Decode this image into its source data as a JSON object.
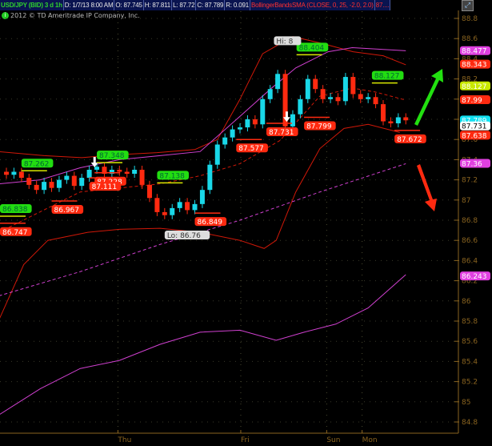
{
  "header": {
    "symbol": "USD/JPY (BID) 3 d 1h",
    "date": "D: 1/7/13 8:00 AM",
    "open": "O: 87.745",
    "high": "H: 87.811",
    "low": "L: 87.72",
    "close": "C: 87.789",
    "range": "R: 0.091",
    "study": "BollingerBandsSMA (CLOSE, 0, 25, -2.0, 2.0)",
    "more": "87...."
  },
  "copyright": "2012 © TD Ameritrade IP Company, Inc.",
  "colors": {
    "up": "#19d8e8",
    "down": "#ff2a10",
    "band": "#d01808",
    "sma": "#d040d0",
    "axis": "#8a6420",
    "green_tag": "#22dd11",
    "red_tag": "#ff2a10"
  },
  "chart_data": {
    "type": "candlestick",
    "title": "USD/JPY (BID) 3 d 1h",
    "ylim": [
      84.7,
      88.9
    ],
    "y_ticks": [
      "88.8",
      "88.6",
      "88.4",
      "88.2",
      "88",
      "87.8",
      "87.6",
      "87.4",
      "87.2",
      "87",
      "86.8",
      "86.6",
      "86.4",
      "86.2",
      "86",
      "85.8",
      "85.6",
      "85.4",
      "85.2",
      "85",
      "84.8"
    ],
    "x_ticks": [
      {
        "label": "Thu",
        "index": 14.8
      },
      {
        "label": "Fri",
        "index": 31.1
      },
      {
        "label": "Sun",
        "index": 42.5
      },
      {
        "label": "Mon",
        "index": 47.2
      }
    ],
    "closes": [
      87.25,
      87.28,
      87.22,
      87.15,
      87.1,
      87.18,
      87.12,
      87.2,
      87.24,
      87.14,
      87.22,
      87.3,
      87.33,
      87.26,
      87.3,
      87.28,
      87.26,
      87.3,
      87.15,
      87.02,
      86.88,
      86.85,
      86.92,
      86.98,
      86.9,
      86.96,
      87.1,
      87.35,
      87.55,
      87.62,
      87.7,
      87.72,
      87.8,
      87.75,
      88.0,
      88.1,
      88.25,
      87.73,
      87.85,
      88.0,
      88.2,
      88.1,
      88.0,
      88.02,
      87.98,
      88.22,
      88.05,
      88.0,
      88.02,
      87.95,
      87.78,
      87.76,
      87.82,
      87.79
    ],
    "lines": [
      {
        "name": "upper-band",
        "color": "#d01808",
        "dash": false,
        "points": [
          [
            -1,
            87.48
          ],
          [
            5,
            87.44
          ],
          [
            10,
            87.42
          ],
          [
            15,
            87.45
          ],
          [
            20,
            87.47
          ],
          [
            25,
            87.5
          ],
          [
            28,
            87.6
          ],
          [
            31,
            88.0
          ],
          [
            34,
            88.45
          ],
          [
            38,
            88.62
          ],
          [
            42,
            88.55
          ],
          [
            46,
            88.47
          ],
          [
            50,
            88.43
          ],
          [
            53,
            88.34
          ]
        ]
      },
      {
        "name": "lower-band",
        "color": "#d01808",
        "dash": false,
        "points": [
          [
            -1,
            85.81
          ],
          [
            2.3,
            86.36
          ],
          [
            5.5,
            86.6
          ],
          [
            10.8,
            86.68
          ],
          [
            15,
            86.71
          ],
          [
            20.4,
            86.72
          ],
          [
            25.7,
            86.68
          ],
          [
            31,
            86.6
          ],
          [
            34.2,
            86.52
          ],
          [
            35.8,
            86.6
          ],
          [
            38.4,
            87.08
          ],
          [
            41.6,
            87.51
          ],
          [
            44.8,
            87.71
          ],
          [
            48,
            87.75
          ],
          [
            52.2,
            87.67
          ]
        ]
      },
      {
        "name": "middle-band",
        "color": "#d01808",
        "dash": true,
        "points": [
          [
            -1,
            86.68
          ],
          [
            9.8,
            87.08
          ],
          [
            20.4,
            87.16
          ],
          [
            25.7,
            87.24
          ],
          [
            31,
            87.36
          ],
          [
            36.3,
            87.59
          ],
          [
            41.6,
            88.03
          ],
          [
            45.9,
            88.11
          ],
          [
            49,
            88.07
          ],
          [
            53,
            87.99
          ]
        ]
      },
      {
        "name": "sma-upper",
        "color": "#d040d0",
        "dash": false,
        "points": [
          [
            -1,
            87.16
          ],
          [
            4.5,
            87.2
          ],
          [
            9.8,
            87.32
          ],
          [
            15,
            87.4
          ],
          [
            20.4,
            87.44
          ],
          [
            25.7,
            87.48
          ],
          [
            31,
            87.83
          ],
          [
            35.2,
            88.11
          ],
          [
            38.4,
            88.31
          ],
          [
            42.7,
            88.47
          ],
          [
            45.9,
            88.51
          ],
          [
            53,
            88.48
          ]
        ]
      },
      {
        "name": "sma-dashed",
        "color": "#d040d0",
        "dash": true,
        "points": [
          [
            -1,
            86.05
          ],
          [
            9.8,
            86.29
          ],
          [
            20.4,
            86.56
          ],
          [
            31,
            86.8
          ],
          [
            41.6,
            87.08
          ],
          [
            53,
            87.36
          ]
        ]
      },
      {
        "name": "sma-lower",
        "color": "#d040d0",
        "dash": false,
        "points": [
          [
            -1,
            84.87
          ],
          [
            4.5,
            85.13
          ],
          [
            9.8,
            85.33
          ],
          [
            15,
            85.41
          ],
          [
            20.4,
            85.57
          ],
          [
            25.7,
            85.69
          ],
          [
            31,
            85.71
          ],
          [
            35.8,
            85.61
          ],
          [
            39.5,
            85.69
          ],
          [
            43.7,
            85.77
          ],
          [
            48,
            85.93
          ],
          [
            53,
            86.26
          ]
        ]
      }
    ],
    "tags": [
      {
        "text": "87.262",
        "kind": "green",
        "index": 2,
        "value": 87.29
      },
      {
        "text": "86.838",
        "kind": "green",
        "index": -1,
        "value": 86.84
      },
      {
        "text": "87.348",
        "kind": "green",
        "index": 12,
        "value": 87.37
      },
      {
        "text": "87.138",
        "kind": "green",
        "index": 20,
        "value": 87.17
      },
      {
        "text": "88.404",
        "kind": "green",
        "index": 38.5,
        "value": 88.44
      },
      {
        "text": "88.127",
        "kind": "green",
        "index": 48.5,
        "value": 88.16
      },
      {
        "text": "86.747",
        "kind": "red",
        "index": -1,
        "value": 86.77
      },
      {
        "text": "86.967",
        "kind": "red",
        "index": 6,
        "value": 86.99
      },
      {
        "text": "87.228",
        "kind": "red",
        "index": 11.7,
        "value": 87.27
      },
      {
        "text": "87.111",
        "kind": "red",
        "index": 11,
        "value": 87.22
      },
      {
        "text": "86.849",
        "kind": "red",
        "index": 25,
        "value": 86.87
      },
      {
        "text": "87.577",
        "kind": "red",
        "index": 30.5,
        "value": 87.6
      },
      {
        "text": "87.731",
        "kind": "red",
        "index": 34.5,
        "value": 87.76
      },
      {
        "text": "87.799",
        "kind": "red",
        "index": 39.5,
        "value": 87.82
      },
      {
        "text": "87.672",
        "kind": "red",
        "index": 51.5,
        "value": 87.69
      },
      {
        "text": "Lo: 86.76",
        "kind": "grey",
        "index": 21,
        "value": 86.76
      },
      {
        "text": "Hi: 8",
        "kind": "grey",
        "index": 35.5,
        "value": 88.48
      }
    ],
    "axis_tags": [
      {
        "text": "88.477",
        "color": "#e040e0",
        "value": 88.477
      },
      {
        "text": "88.343",
        "color": "#ff2a10",
        "value": 88.343
      },
      {
        "text": "88.127",
        "color": "#c8e800",
        "value": 88.127
      },
      {
        "text": "87.99",
        "color": "#ff2a10",
        "value": 87.99
      },
      {
        "text": "87.789",
        "color": "#10e0f0",
        "value": 87.789
      },
      {
        "text": "87.731",
        "color": "#ffffff",
        "value": 87.731
      },
      {
        "text": "87.638",
        "color": "#ff2a10",
        "value": 87.638
      },
      {
        "text": "87.36",
        "color": "#e040e0",
        "value": 87.36
      },
      {
        "text": "86.243",
        "color": "#e040e0",
        "value": 86.243
      }
    ],
    "signal_arrows": [
      {
        "dir": "down",
        "index": 11.7,
        "value": 87.3
      },
      {
        "dir": "down",
        "index": 37.2,
        "value": 87.75
      }
    ]
  }
}
